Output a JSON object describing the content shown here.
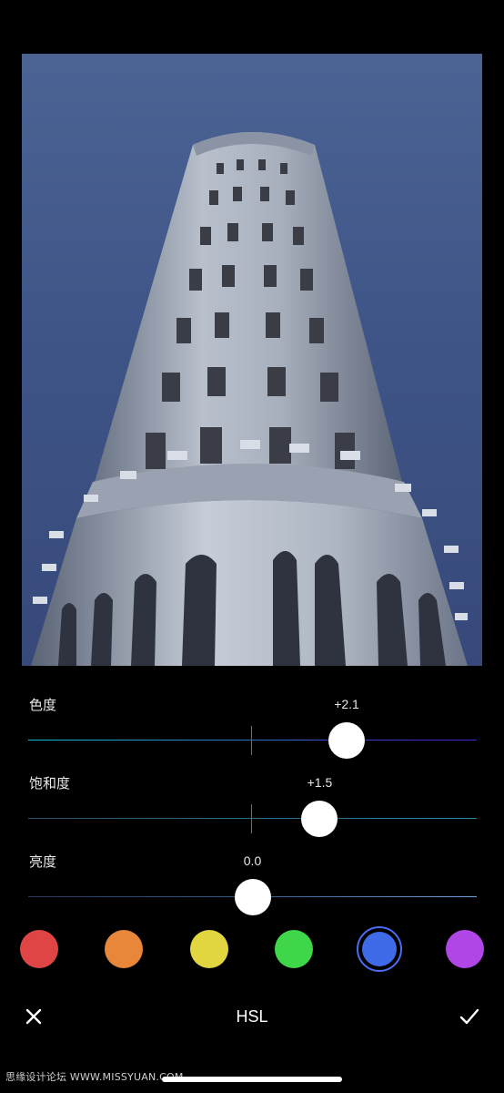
{
  "editor": {
    "title": "HSL",
    "sliders": [
      {
        "label": "色度",
        "value_text": "+2.1",
        "value": 2.1
      },
      {
        "label": "饱和度",
        "value_text": "+1.5",
        "value": 1.5
      },
      {
        "label": "亮度",
        "value_text": "0.0",
        "value": 0.0
      }
    ],
    "slider_range": [
      -5,
      5
    ]
  },
  "swatches": [
    {
      "name": "red",
      "color": "#e04545"
    },
    {
      "name": "orange",
      "color": "#e8863a"
    },
    {
      "name": "yellow",
      "color": "#e2d640"
    },
    {
      "name": "green",
      "color": "#3fd64a"
    },
    {
      "name": "blue",
      "color": "#3f6ae8",
      "selected": true
    },
    {
      "name": "purple",
      "color": "#b146e6"
    }
  ],
  "toolbar": {
    "cancel_icon": "close-icon",
    "confirm_icon": "checkmark-icon"
  },
  "watermark": "思缘设计论坛 WWW.MISSYUAN.COM"
}
